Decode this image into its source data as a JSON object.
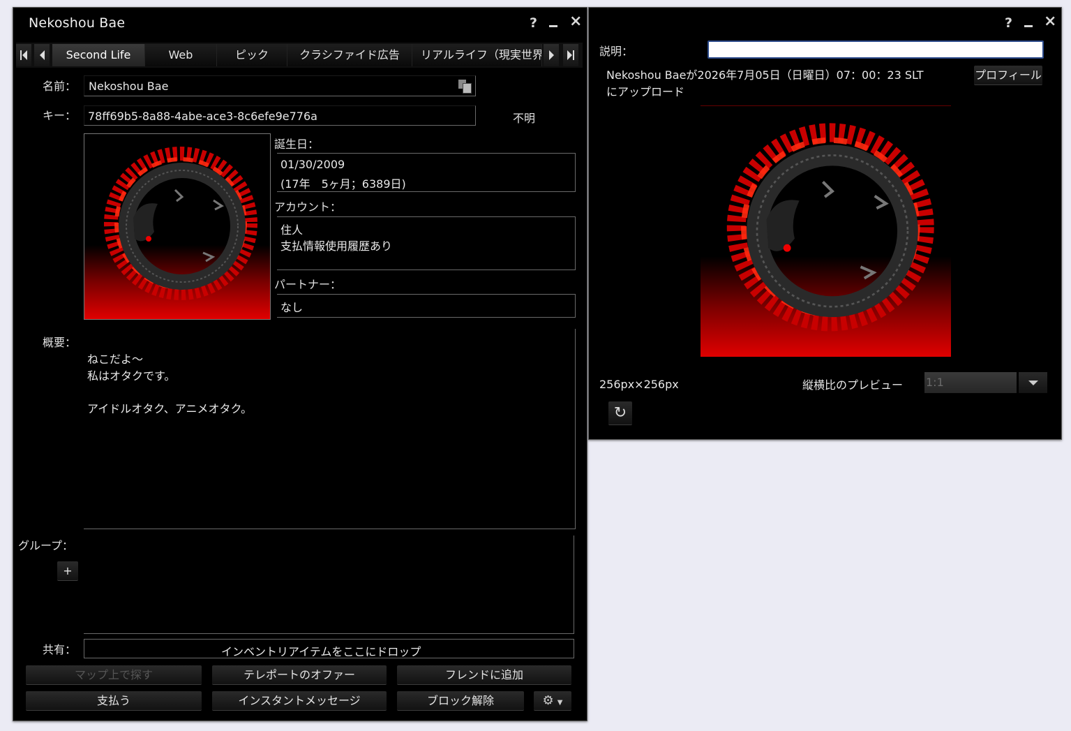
{
  "profile_window": {
    "title": "Nekoshou Bae",
    "help_label": "?",
    "minimize_label": "_",
    "close_label": "×",
    "tabs": [
      "Second Life",
      "Web",
      "ピック",
      "クラシファイド広告",
      "リアルライフ（現実世界）"
    ],
    "name_label": "名前：",
    "name_value": "Nekoshou Bae",
    "key_label": "キー：",
    "key_value": "78ff69b5-8a88-4abe-ace3-8c6efe9e776a",
    "status_value": "不明",
    "birthday_label": "誕生日：",
    "birthday_line1": "01/30/2009",
    "birthday_line2": "(17年　5ヶ月；6389日)",
    "account_label": "アカウント：",
    "account_line1": "住人",
    "account_line2": "支払情報使用履歴あり",
    "partner_label": "パートナー：",
    "partner_value": "なし",
    "about_label": "概要：",
    "about_lines": [
      "ねこだよ～",
      "私はオタクです。",
      "",
      "アイドルオタク、アニメオタク。"
    ],
    "groups_label": "グループ：",
    "add_group_label": "+",
    "share_label": "共有：",
    "share_drop_text": "インベントリアイテムをここにドロップ",
    "buttons": {
      "map": "マップ上で探す",
      "teleport": "テレポートのオファー",
      "add_friend": "フレンドに追加",
      "pay": "支払う",
      "im": "インスタントメッセージ",
      "unblock": "ブロック解除"
    }
  },
  "texture_window": {
    "help_label": "?",
    "minimize_label": "_",
    "close_label": "×",
    "description_label": "説明：",
    "description_value": "",
    "upload_info_line1": "Nekoshou Baeが2026年7月05日（日曜日）07：00：23 SLT",
    "upload_info_line2": "にアップロード",
    "profile_button": "プロフィール",
    "dimensions": "256px×256px",
    "aspect_label": "縦横比のプレビュー",
    "aspect_value": "1:1"
  },
  "colors": {
    "background": "#ebebf4",
    "window": "#000000",
    "accent_red": "#d40000"
  },
  "icons": [
    "copy-icon",
    "refresh-icon",
    "gear-icon",
    "dropdown-arrow-icon",
    "first-tab-icon",
    "prev-tab-icon",
    "next-tab-icon",
    "last-tab-icon"
  ]
}
